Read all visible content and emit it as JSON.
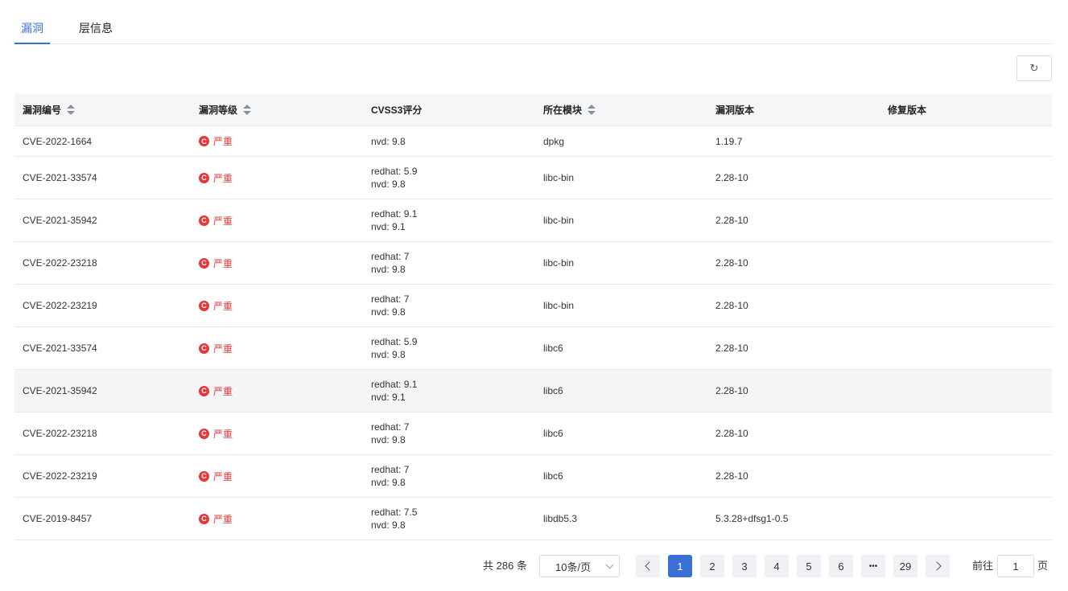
{
  "tabs": [
    {
      "label": "漏洞",
      "active": true
    },
    {
      "label": "层信息",
      "active": false
    }
  ],
  "toolbar": {
    "refresh_icon": "↻"
  },
  "table": {
    "headers": [
      "漏洞编号",
      "漏洞等级",
      "CVSS3评分",
      "所在模块",
      "漏洞版本",
      "修复版本"
    ],
    "severity_icon": "C",
    "rows": [
      {
        "id": "CVE-2022-1664",
        "severity": "严重",
        "scores": [
          "nvd: 9.8"
        ],
        "module": "dpkg",
        "version": "1.19.7",
        "fix": ""
      },
      {
        "id": "CVE-2021-33574",
        "severity": "严重",
        "scores": [
          "redhat: 5.9",
          "nvd: 9.8"
        ],
        "module": "libc-bin",
        "version": "2.28-10",
        "fix": ""
      },
      {
        "id": "CVE-2021-35942",
        "severity": "严重",
        "scores": [
          "redhat: 9.1",
          "nvd: 9.1"
        ],
        "module": "libc-bin",
        "version": "2.28-10",
        "fix": ""
      },
      {
        "id": "CVE-2022-23218",
        "severity": "严重",
        "scores": [
          "redhat: 7",
          "nvd: 9.8"
        ],
        "module": "libc-bin",
        "version": "2.28-10",
        "fix": ""
      },
      {
        "id": "CVE-2022-23219",
        "severity": "严重",
        "scores": [
          "redhat: 7",
          "nvd: 9.8"
        ],
        "module": "libc-bin",
        "version": "2.28-10",
        "fix": ""
      },
      {
        "id": "CVE-2021-33574",
        "severity": "严重",
        "scores": [
          "redhat: 5.9",
          "nvd: 9.8"
        ],
        "module": "libc6",
        "version": "2.28-10",
        "fix": ""
      },
      {
        "id": "CVE-2021-35942",
        "severity": "严重",
        "scores": [
          "redhat: 9.1",
          "nvd: 9.1"
        ],
        "module": "libc6",
        "version": "2.28-10",
        "fix": ""
      },
      {
        "id": "CVE-2022-23218",
        "severity": "严重",
        "scores": [
          "redhat: 7",
          "nvd: 9.8"
        ],
        "module": "libc6",
        "version": "2.28-10",
        "fix": ""
      },
      {
        "id": "CVE-2022-23219",
        "severity": "严重",
        "scores": [
          "redhat: 7",
          "nvd: 9.8"
        ],
        "module": "libc6",
        "version": "2.28-10",
        "fix": ""
      },
      {
        "id": "CVE-2019-8457",
        "severity": "严重",
        "scores": [
          "redhat: 7.5",
          "nvd: 9.8"
        ],
        "module": "libdb5.3",
        "version": "5.3.28+dfsg1-0.5",
        "fix": ""
      }
    ]
  },
  "pagination": {
    "total_text": "共 286 条",
    "page_size": "10条/页",
    "pages": [
      "1",
      "2",
      "3",
      "4",
      "5",
      "6",
      "•••",
      "29"
    ],
    "current": "1",
    "goto_label": "前往",
    "goto_value": "1",
    "goto_suffix": "页"
  }
}
